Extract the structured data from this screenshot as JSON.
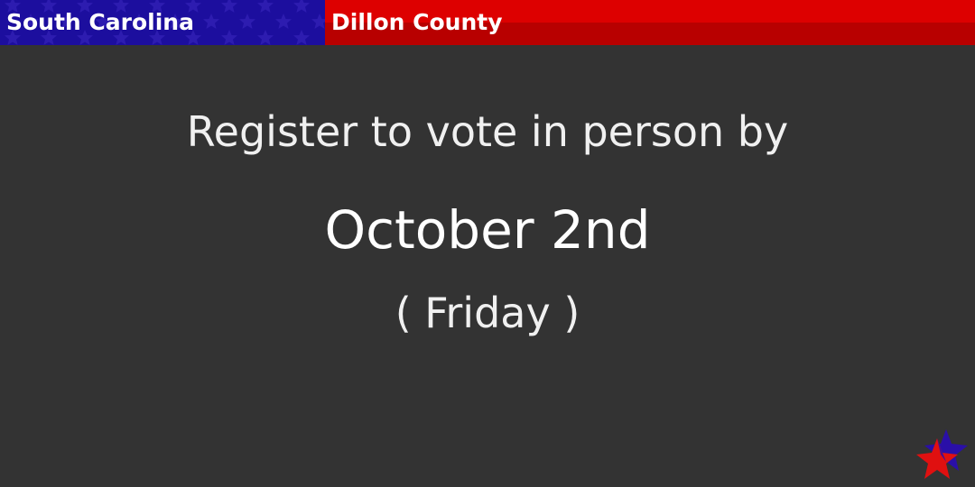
{
  "header": {
    "state": "South Carolina",
    "county": "Dillon County"
  },
  "message": {
    "intro": "Register to vote in person by",
    "date": "October 2nd",
    "weekday": "( Friday )"
  },
  "colors": {
    "background": "#333333",
    "state_band": "#1c0e9e",
    "county_band_top": "#dd0000",
    "county_band_bottom": "#b80000",
    "text": "#f0f0f0",
    "star_blue": "#2a0fa8",
    "star_red": "#e01010"
  },
  "icons": {
    "state_band_pattern": "stars-pattern",
    "corner_logo": "star-icon"
  }
}
